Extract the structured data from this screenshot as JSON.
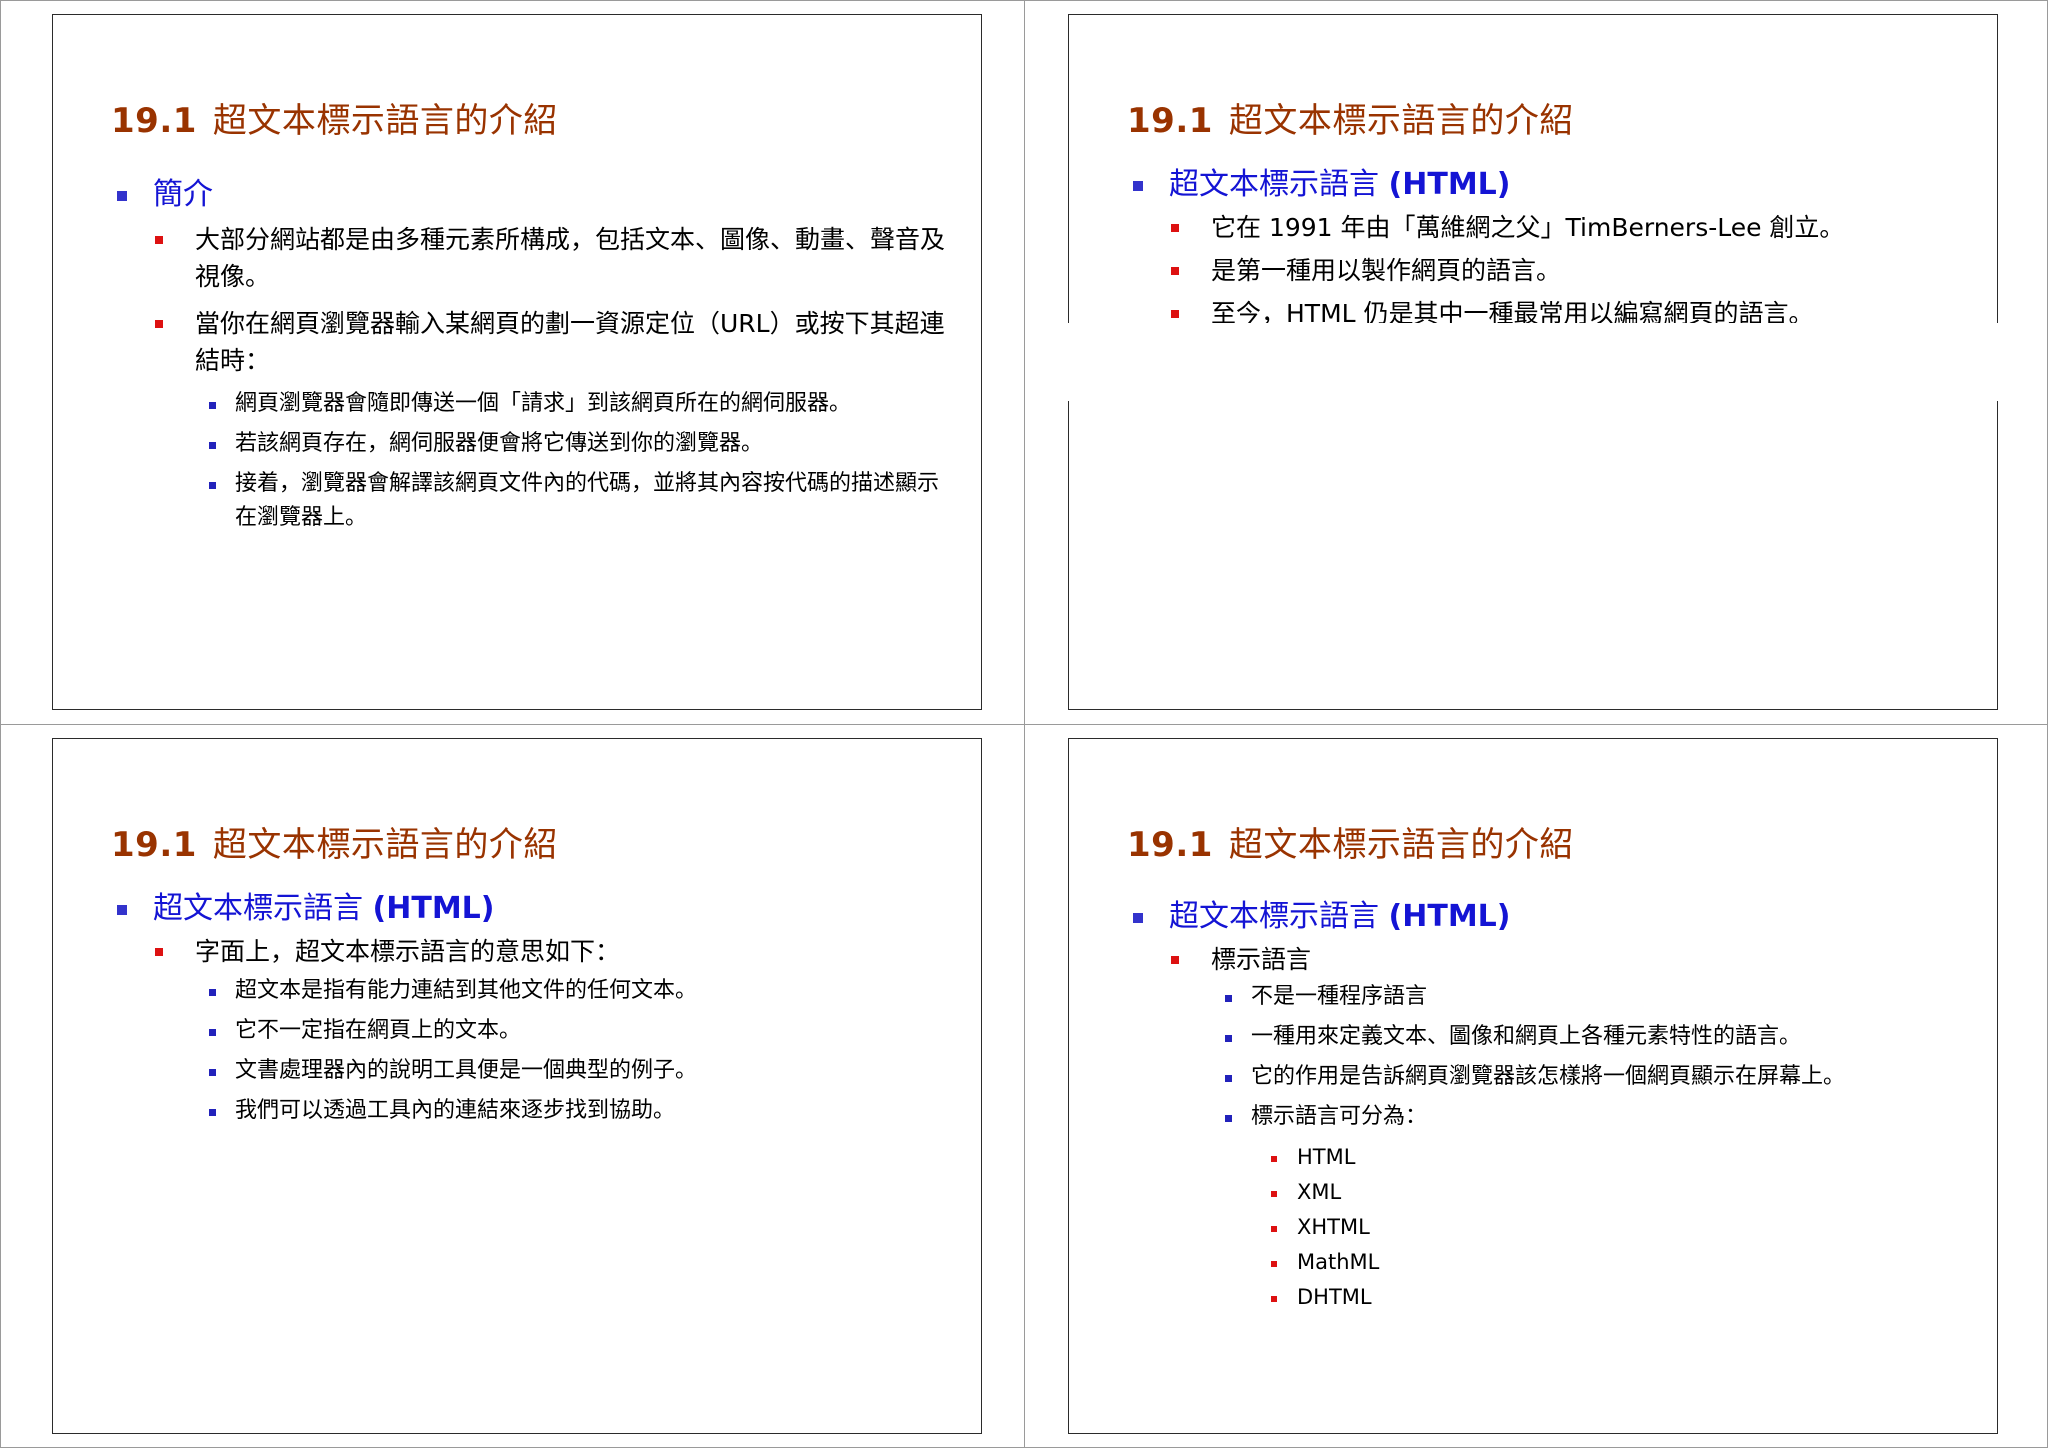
{
  "slides": [
    {
      "title_num": "19.1",
      "title_text": "超文本標示語言的介紹",
      "heading": "簡介",
      "items": [
        {
          "text": "大部分網站都是由多種元素所構成，包括文本、圖像、動畫、聲音及視像。"
        },
        {
          "text": "當你在網頁瀏覽器輸入某網頁的劃一資源定位（URL）或按下其超連結時：",
          "subitems": [
            "網頁瀏覽器會隨即傳送一個「請求」到該網頁所在的網伺服器。",
            "若該網頁存在，網伺服器便會將它傳送到你的瀏覽器。",
            "接着，瀏覽器會解譯該網頁文件內的代碼，並將其內容按代碼的描述顯示在瀏覽器上。"
          ]
        }
      ]
    },
    {
      "title_num": "19.1",
      "title_text": "超文本標示語言的介紹",
      "heading": "超文本標示語言 ",
      "heading_bold": "(HTML)",
      "items": [
        "它在 1991 年由「萬維網之父」TimBerners-Lee 創立。",
        "是第一種用以製作網頁的語言。",
        "至今，HTML 仍是其中一種最常用以編寫網頁的語言。"
      ]
    },
    {
      "title_num": "19.1",
      "title_text": "超文本標示語言的介紹",
      "heading": "超文本標示語言 ",
      "heading_bold": "(HTML)",
      "item": "字面上，超文本標示語言的意思如下：",
      "subitems": [
        "超文本是指有能力連結到其他文件的任何文本。",
        "它不一定指在網頁上的文本。",
        "文書處理器內的說明工具便是一個典型的例子。",
        "我們可以透過工具內的連結來逐步找到協助。"
      ]
    },
    {
      "title_num": "19.1",
      "title_text": "超文本標示語言的介紹",
      "heading": "超文本標示語言 ",
      "heading_bold": "(HTML)",
      "item": "標示語言",
      "subitems": [
        "不是一種程序語言",
        "一種用來定義文本、圖像和網頁上各種元素特性的語言。",
        "它的作用是告訴網頁瀏覽器該怎樣將一個網頁顯示在屏幕上。",
        "標示語言可分為："
      ],
      "languages": [
        "HTML",
        "XML",
        "XHTML",
        "MathML",
        "DHTML"
      ]
    }
  ],
  "colors": {
    "title": "#993300",
    "heading": "#1414d4",
    "bullet_red": "#dd1111",
    "bullet_blue": "#2222bb"
  }
}
